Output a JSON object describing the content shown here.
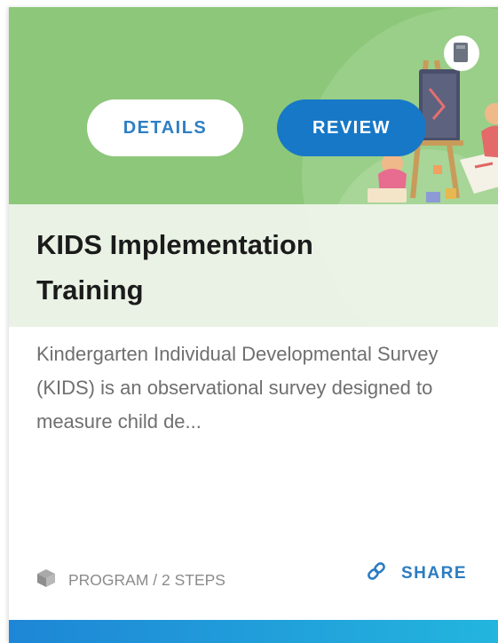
{
  "card": {
    "buttons": {
      "details_label": "DETAILS",
      "review_label": "REVIEW"
    },
    "title": "KIDS Implementation Training",
    "description": "Kindergarten Individual Developmental Survey (KIDS) is an observational survey designed to measure child de...",
    "meta": {
      "icon": "cube-icon",
      "text": "PROGRAM / 2 STEPS"
    },
    "share": {
      "icon": "link-icon",
      "label": "SHARE"
    },
    "colors": {
      "hero_green": "#8dc77a",
      "primary_blue": "#1778c7",
      "details_text": "#2f7fc4"
    }
  }
}
